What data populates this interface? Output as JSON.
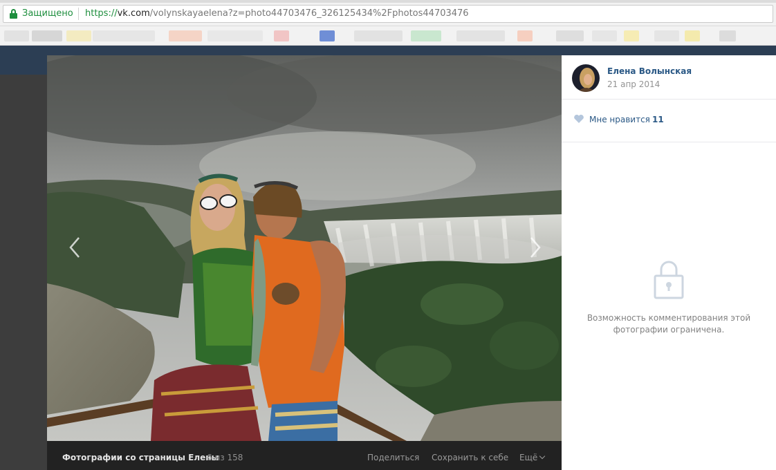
{
  "browser": {
    "secure_label": "Защищено",
    "url_scheme": "https://",
    "url_host": "vk.com",
    "url_path": "/volynskayaelena?z=photo44703476_326125434%2Fphotos44703476",
    "bookmark_colors": [
      "#e2e2e2",
      "#d6d6d6",
      "#f3ebc1",
      "#e6e6e6",
      "#f5d4c6",
      "#e8e8e8",
      "#f1c5c5",
      "#6f8ed6",
      "#e2e2e2",
      "#c9e7cf",
      "#e3e3e3",
      "#f6cfc0",
      "#dedede",
      "#e6e6e6",
      "#f6ecb4",
      "#e5e5e5",
      "#f4eaad",
      "#dcdcdc"
    ]
  },
  "photo": {
    "prev_icon": "chevron-left-icon",
    "next_icon": "chevron-right-icon"
  },
  "footer": {
    "album_title": "Фотографии со страницы Елены",
    "counter": "6 из 158",
    "share": "Поделиться",
    "save": "Сохранить к себе",
    "more": "Ещё"
  },
  "sidebar": {
    "author_name": "Елена Волынская",
    "date": "21 апр 2014",
    "like_label": "Мне нравится",
    "like_count": "11",
    "like_icon": "heart-icon",
    "lock_icon": "lock-icon",
    "comments_restricted": "Возможность комментирования этой фотографии ограничена."
  },
  "colors": {
    "link": "#2a5885",
    "secure_green": "#1e8e3e",
    "header_blue": "#2c3e54",
    "footer_dark": "#222222"
  }
}
